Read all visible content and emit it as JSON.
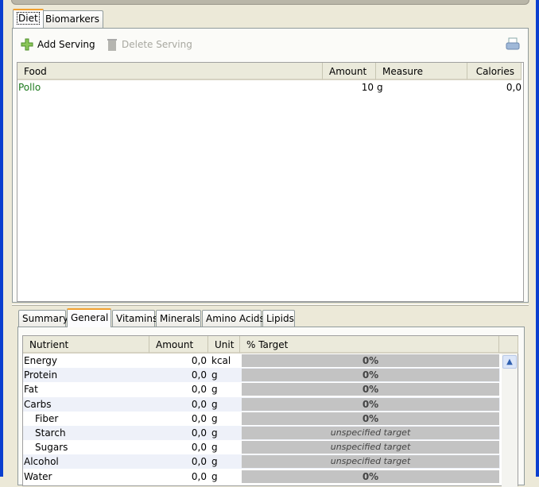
{
  "main_tabs": [
    {
      "label": "Diet",
      "active": true
    },
    {
      "label": "Biomarkers",
      "active": false
    }
  ],
  "toolbar": {
    "add_label": "Add Serving",
    "delete_label": "Delete Serving",
    "print_icon": "print-icon"
  },
  "food_table": {
    "headers": [
      "Food",
      "Amount",
      "Measure",
      "Calories"
    ],
    "rows": [
      {
        "food": "Pollo",
        "amount": "10",
        "measure": "g",
        "calories": "0,0"
      }
    ]
  },
  "nutrient_tabs": [
    {
      "label": "Summary"
    },
    {
      "label": "General",
      "active": true
    },
    {
      "label": "Vitamins"
    },
    {
      "label": "Minerals"
    },
    {
      "label": "Amino Acids"
    },
    {
      "label": "Lipids"
    }
  ],
  "nutrient_table": {
    "headers": [
      "Nutrient",
      "Amount",
      "Unit",
      "% Target"
    ],
    "rows": [
      {
        "name": "Energy",
        "amount": "0,0",
        "unit": "kcal",
        "target": "0%"
      },
      {
        "name": "Protein",
        "amount": "0,0",
        "unit": "g",
        "target": "0%"
      },
      {
        "name": "Fat",
        "amount": "0,0",
        "unit": "g",
        "target": "0%"
      },
      {
        "name": "Carbs",
        "amount": "0,0",
        "unit": "g",
        "target": "0%"
      },
      {
        "name": "Fiber",
        "amount": "0,0",
        "unit": "g",
        "target": "0%",
        "indent": true
      },
      {
        "name": "Starch",
        "amount": "0,0",
        "unit": "g",
        "target": "unspecified target",
        "indent": true
      },
      {
        "name": "Sugars",
        "amount": "0,0",
        "unit": "g",
        "target": "unspecified target",
        "indent": true
      },
      {
        "name": "Alcohol",
        "amount": "0,0",
        "unit": "g",
        "target": "unspecified target"
      },
      {
        "name": "Water",
        "amount": "0,0",
        "unit": "g",
        "target": "0%"
      }
    ]
  },
  "colors": {
    "food_text": "#1e7a1e",
    "bar": "#c3c3c3",
    "window_border": "#0a3ecf",
    "tab_highlight": "#f0a030"
  }
}
